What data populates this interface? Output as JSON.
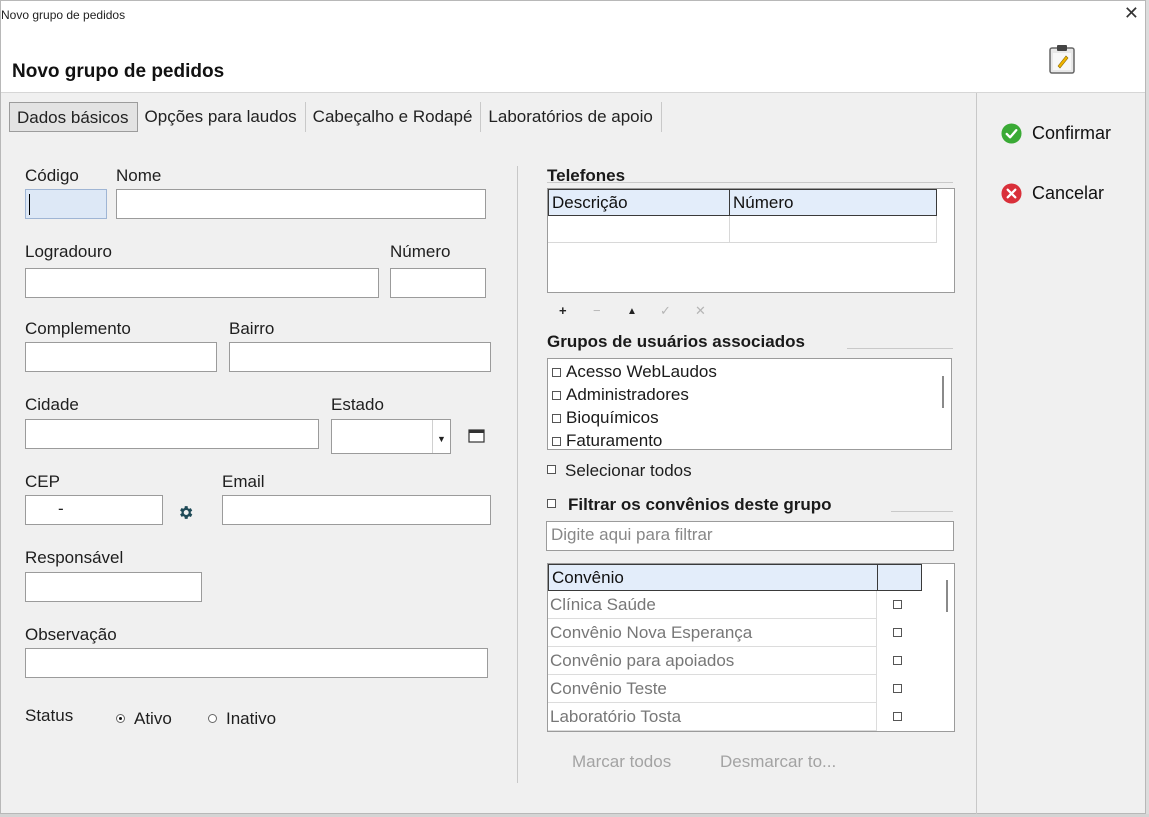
{
  "window": {
    "title": "Novo grupo de pedidos",
    "close_glyph": "✕"
  },
  "header": {
    "title": "Novo grupo de pedidos",
    "icon": "clipboard-icon"
  },
  "tabs": [
    {
      "label": "Dados básicos",
      "active": true
    },
    {
      "label": "Opções para laudos",
      "active": false
    },
    {
      "label": "Cabeçalho e Rodapé",
      "active": false
    },
    {
      "label": "Laboratórios de apoio",
      "active": false
    }
  ],
  "form": {
    "codigo": {
      "label": "Código",
      "value": ""
    },
    "nome": {
      "label": "Nome",
      "value": ""
    },
    "logradouro": {
      "label": "Logradouro",
      "value": ""
    },
    "numero": {
      "label": "Número",
      "value": ""
    },
    "complemento": {
      "label": "Complemento",
      "value": ""
    },
    "bairro": {
      "label": "Bairro",
      "value": ""
    },
    "cidade": {
      "label": "Cidade",
      "value": ""
    },
    "estado": {
      "label": "Estado",
      "value": ""
    },
    "cep": {
      "label": "CEP",
      "value": "-"
    },
    "email": {
      "label": "Email",
      "value": ""
    },
    "responsavel": {
      "label": "Responsável",
      "value": ""
    },
    "observacao": {
      "label": "Observação",
      "value": ""
    },
    "status": {
      "label": "Status",
      "options": [
        "Ativo",
        "Inativo"
      ],
      "selected": "Ativo"
    }
  },
  "telefones": {
    "title": "Telefones",
    "columns": [
      "Descrição",
      "Número"
    ],
    "toolbar": [
      "+",
      "−",
      "▲",
      "✓",
      "✕"
    ]
  },
  "grupos": {
    "title": "Grupos de usuários associados",
    "items": [
      "Acesso WebLaudos",
      "Administradores",
      "Bioquímicos",
      "Faturamento"
    ],
    "select_all": "Selecionar todos"
  },
  "convenios": {
    "filter_title": "Filtrar os convênios deste grupo",
    "filter_placeholder": "Digite aqui para filtrar",
    "column": "Convênio",
    "rows": [
      "Clínica Saúde",
      "Convênio Nova Esperança",
      "Convênio para apoiados",
      "Convênio Teste",
      "Laboratório Tosta"
    ],
    "mark_all": "Marcar todos",
    "unmark_all": "Desmarcar to..."
  },
  "actions": {
    "confirm": "Confirmar",
    "cancel": "Cancelar",
    "confirm_color": "#3aaa35",
    "cancel_color": "#d9303a"
  }
}
